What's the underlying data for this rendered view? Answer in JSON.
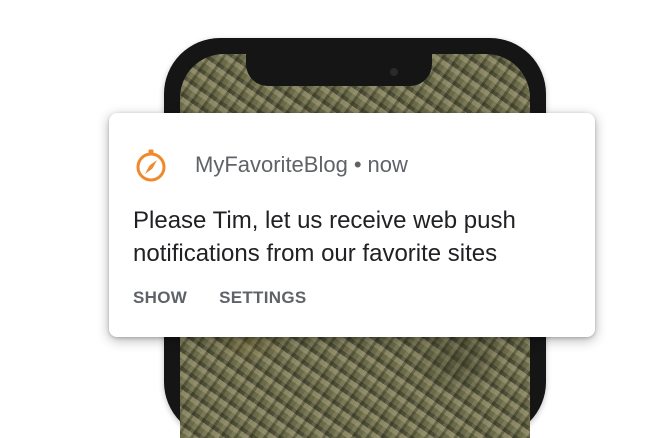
{
  "notification": {
    "app_name": "MyFavoriteBlog",
    "separator": "•",
    "time": "now",
    "message": "Please Tim, let us receive web push notifications from our favorite sites",
    "actions": [
      {
        "label": "SHOW"
      },
      {
        "label": "SETTINGS"
      }
    ],
    "icon": "compass-icon",
    "accent_color": "#F0892B"
  },
  "device": {
    "type": "smartphone",
    "frame_color": "#151515"
  }
}
